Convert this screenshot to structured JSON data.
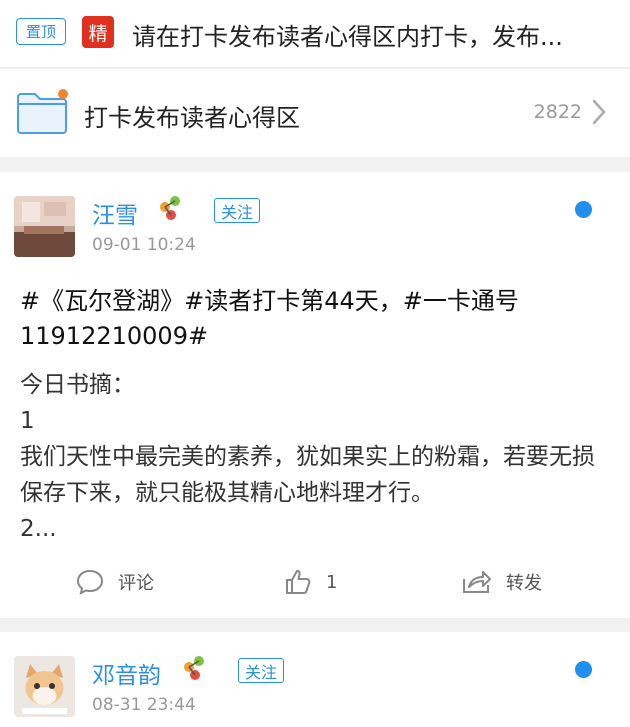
{
  "pinned": {
    "tag_top": "置顶",
    "tag_jing": "精",
    "title": "请在打卡发布读者心得区内打卡，发布..."
  },
  "topic": {
    "name": "打卡发布读者心得区",
    "count": "2822",
    "icon": "folder-icon"
  },
  "posts": [
    {
      "username": "汪雪",
      "follow_label": "关注",
      "time": "09-01 10:24",
      "title": "#《瓦尔登湖》#读者打卡第44天，#一卡通号11912210009#",
      "body": [
        "今日书摘：",
        "1",
        "我们天性中最完美的素养，犹如果实上的粉霜，若要无损保存下来，就只能极其精心地料理才行。",
        "2..."
      ],
      "comment_label": "评论",
      "like_count": "1",
      "forward_label": "转发"
    },
    {
      "username": "邓音韵",
      "follow_label": "关注",
      "time": "08-31 23:44"
    }
  ],
  "colors": {
    "accent": "#2b8fe6",
    "jing_red": "#e0301e",
    "dot_blue": "#1f8ff0"
  }
}
